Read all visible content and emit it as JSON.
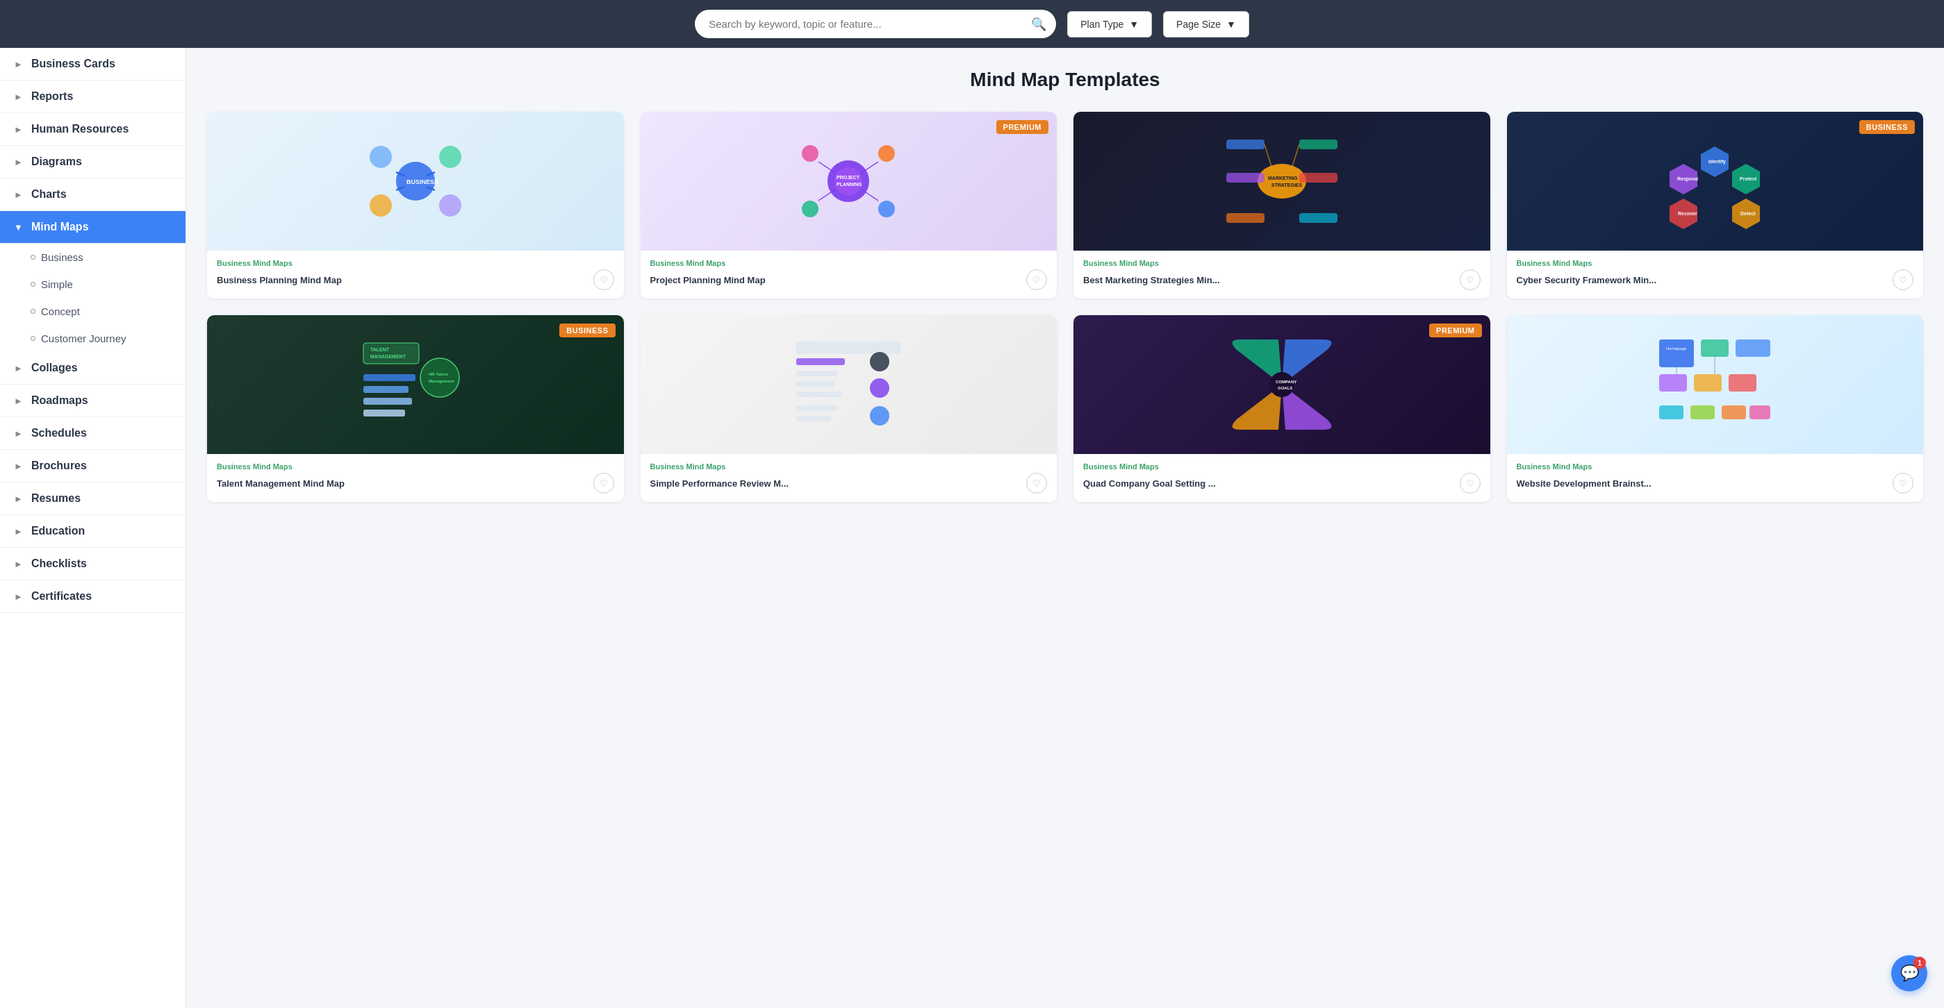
{
  "topbar": {
    "search_placeholder": "Search by keyword, topic or feature...",
    "filter1_label": "Plan Type",
    "filter2_label": "Page Size"
  },
  "sidebar": {
    "items": [
      {
        "id": "business-cards",
        "label": "Business Cards",
        "active": false,
        "expanded": false
      },
      {
        "id": "reports",
        "label": "Reports",
        "active": false,
        "expanded": false
      },
      {
        "id": "human-resources",
        "label": "Human Resources",
        "active": false,
        "expanded": false
      },
      {
        "id": "diagrams",
        "label": "Diagrams",
        "active": false,
        "expanded": false
      },
      {
        "id": "charts",
        "label": "Charts",
        "active": false,
        "expanded": false
      },
      {
        "id": "mind-maps",
        "label": "Mind Maps",
        "active": true,
        "expanded": true
      },
      {
        "id": "collages",
        "label": "Collages",
        "active": false,
        "expanded": false
      },
      {
        "id": "roadmaps",
        "label": "Roadmaps",
        "active": false,
        "expanded": false
      },
      {
        "id": "schedules",
        "label": "Schedules",
        "active": false,
        "expanded": false
      },
      {
        "id": "brochures",
        "label": "Brochures",
        "active": false,
        "expanded": false
      },
      {
        "id": "resumes",
        "label": "Resumes",
        "active": false,
        "expanded": false
      },
      {
        "id": "education",
        "label": "Education",
        "active": false,
        "expanded": false
      },
      {
        "id": "checklists",
        "label": "Checklists",
        "active": false,
        "expanded": false
      },
      {
        "id": "certificates",
        "label": "Certificates",
        "active": false,
        "expanded": false
      }
    ],
    "sub_items": [
      {
        "id": "business",
        "label": "Business"
      },
      {
        "id": "simple",
        "label": "Simple"
      },
      {
        "id": "concept",
        "label": "Concept"
      },
      {
        "id": "customer-journey",
        "label": "Customer Journey"
      }
    ]
  },
  "content": {
    "page_title": "Mind Map Templates",
    "cards": [
      {
        "id": "card-1",
        "category": "Business Mind Maps",
        "name": "Business Planning Mind Map",
        "badge": null,
        "img_class": "card-img-1"
      },
      {
        "id": "card-2",
        "category": "Business Mind Maps",
        "name": "Project Planning Mind Map",
        "badge": "PREMIUM",
        "badge_type": "badge-premium",
        "img_class": "card-img-2"
      },
      {
        "id": "card-3",
        "category": "Business Mind Maps",
        "name": "Best Marketing Strategies Min...",
        "badge": null,
        "img_class": "card-img-3"
      },
      {
        "id": "card-4",
        "category": "Business Mind Maps",
        "name": "Cyber Security Framework Min...",
        "badge": "BUSINESS",
        "badge_type": "badge-business",
        "img_class": "card-img-4"
      },
      {
        "id": "card-5",
        "category": "Business Mind Maps",
        "name": "Talent Management Mind Map",
        "badge": "BUSINESS",
        "badge_type": "badge-business",
        "img_class": "card-img-5"
      },
      {
        "id": "card-6",
        "category": "Business Mind Maps",
        "name": "Simple Performance Review M...",
        "badge": null,
        "img_class": "card-img-6"
      },
      {
        "id": "card-7",
        "category": "Business Mind Maps",
        "name": "Quad Company Goal Setting ...",
        "badge": "PREMIUM",
        "badge_type": "badge-premium",
        "img_class": "card-img-7"
      },
      {
        "id": "card-8",
        "category": "Business Mind Maps",
        "name": "Website Development Brainst...",
        "badge": null,
        "img_class": "card-img-8"
      }
    ]
  },
  "chat": {
    "badge_count": "1"
  }
}
